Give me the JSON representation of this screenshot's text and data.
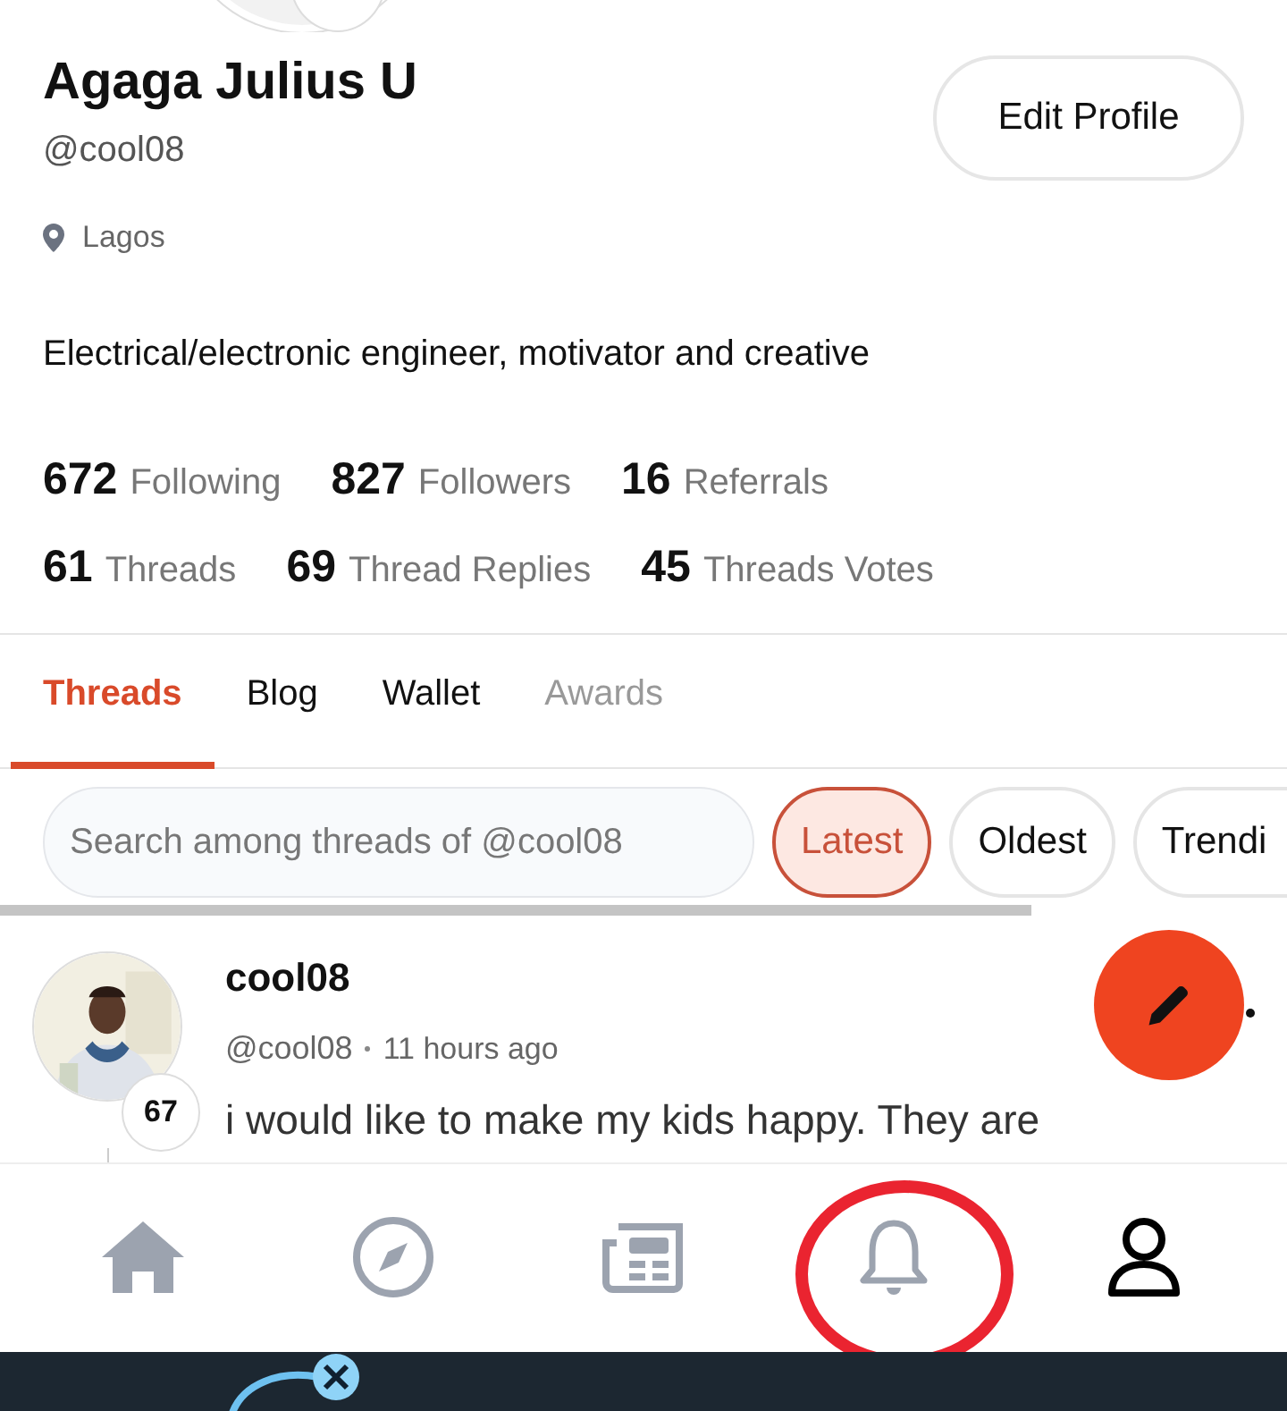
{
  "profile": {
    "name": "Agaga Julius U",
    "handle": "@cool08",
    "location": "Lagos",
    "bio": "Electrical/electronic engineer, motivator and creative",
    "edit_button": "Edit Profile"
  },
  "stats": [
    [
      {
        "count": "672",
        "name": "Following"
      },
      {
        "count": "827",
        "name": "Followers"
      },
      {
        "count": "16",
        "name": "Referrals"
      }
    ],
    [
      {
        "count": "61",
        "name": "Threads"
      },
      {
        "count": "69",
        "name": "Thread Replies"
      },
      {
        "count": "45",
        "name": "Threads Votes"
      }
    ]
  ],
  "tabs": [
    {
      "label": "Threads",
      "selected": true,
      "disabled": false
    },
    {
      "label": "Blog",
      "selected": false,
      "disabled": false
    },
    {
      "label": "Wallet",
      "selected": false,
      "disabled": false
    },
    {
      "label": "Awards",
      "selected": false,
      "disabled": true
    }
  ],
  "search": {
    "placeholder": "Search among threads of @cool08"
  },
  "filters": [
    {
      "label": "Latest",
      "selected": true
    },
    {
      "label": "Oldest",
      "selected": false
    },
    {
      "label": "Trendi",
      "selected": false
    }
  ],
  "post": {
    "author": "cool08",
    "handle": "@cool08",
    "time": "11 hours ago",
    "badge": "67",
    "text": "i would like to make my kids happy. They are"
  },
  "bottom_nav": [
    {
      "kind": "home",
      "selected": false
    },
    {
      "kind": "explore",
      "selected": false
    },
    {
      "kind": "news",
      "selected": false
    },
    {
      "kind": "notifications",
      "selected": false
    },
    {
      "kind": "profile",
      "selected": true
    }
  ]
}
